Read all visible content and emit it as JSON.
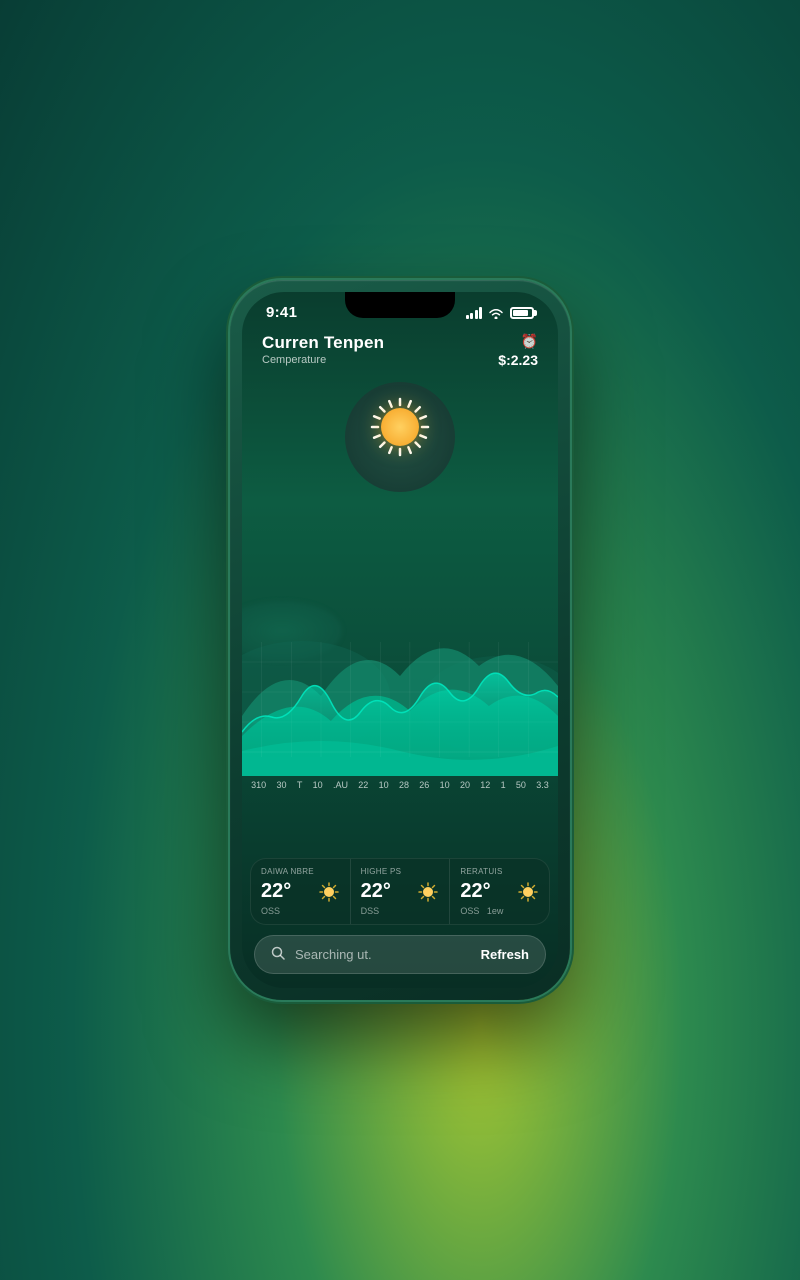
{
  "status_bar": {
    "time": "9:41",
    "battery_percent": 85
  },
  "header": {
    "title": "Curren Tenpen",
    "subtitle": "Cemperature",
    "clock_icon": "⏰",
    "value": "$:2.23"
  },
  "chart": {
    "labels": [
      "310",
      "30",
      "T",
      "10",
      ".AU",
      "22",
      "10",
      "28",
      "26",
      "10",
      "20",
      "12",
      "1",
      "50",
      "3.3"
    ]
  },
  "weather_cards": [
    {
      "label": "DAIWA NBRE",
      "temp": "22°",
      "desc": "OSS",
      "desc2": ""
    },
    {
      "label": "HIGHE PS",
      "temp": "22°",
      "desc": "DSS",
      "desc2": ""
    },
    {
      "label": "RERATUIS",
      "temp": "22°",
      "desc": "OSS",
      "desc2": "1ew"
    }
  ],
  "search": {
    "placeholder": "Searching ut.",
    "refresh_label": "Refresh"
  }
}
